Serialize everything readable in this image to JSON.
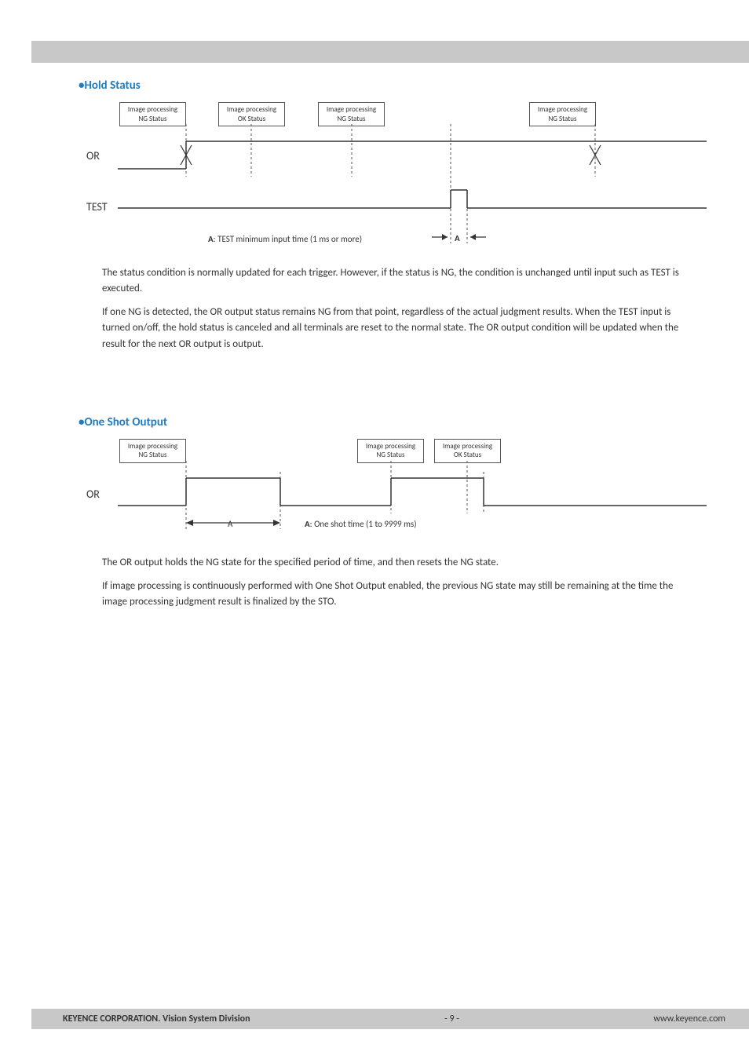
{
  "sections": {
    "hold": {
      "heading": "•Hold Status",
      "boxes": {
        "b1": {
          "line1": "Image processing",
          "line2": "NG Status"
        },
        "b2": {
          "line1": "Image processing",
          "line2": "OK Status"
        },
        "b3": {
          "line1": "Image processing",
          "line2": "NG Status"
        },
        "b4": {
          "line1": "Image processing",
          "line2": "NG Status"
        }
      },
      "or_label": "OR",
      "test_label": "TEST",
      "caption_prefix": "A",
      "caption_text": ": TEST minimum input time (1 ms or more)",
      "a_marker": "A",
      "para1": "The status condition is normally updated for each trigger. However, if the status is NG, the condition is unchanged until input such as TEST is executed.",
      "para2": "If one NG is detected, the OR output status remains NG from that point, regardless of the actual judgment results.  When the TEST input is turned on/off, the hold status is canceled and all terminals are reset to the normal state. The OR output condition will be updated when the result for the next OR output is output."
    },
    "oneshot": {
      "heading": "•One Shot Output",
      "boxes": {
        "b1": {
          "line1": "Image processing",
          "line2": "NG Status"
        },
        "b2": {
          "line1": "Image processing",
          "line2": "NG Status"
        },
        "b3": {
          "line1": "Image processing",
          "line2": "OK Status"
        }
      },
      "or_label": "OR",
      "a_marker": "A",
      "caption_prefix": "A",
      "caption_text": ": One shot time (1 to 9999 ms)",
      "para1": "The OR output holds the NG state for the specified period of time, and then resets the NG state.",
      "para2": "If image processing is continuously performed with One Shot Output enabled, the previous NG state may still be remaining at the time the image processing judgment result is finalized by the STO."
    }
  },
  "footer": {
    "left": "KEYENCE CORPORATION. Vision System Division",
    "center": "- 9 -",
    "right": "www.keyence.com"
  }
}
